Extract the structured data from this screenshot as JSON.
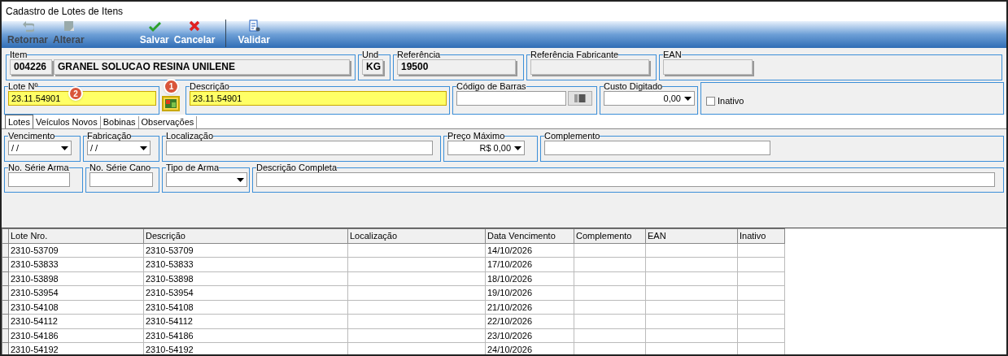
{
  "window": {
    "title": "Cadastro de Lotes de Itens"
  },
  "toolbar": [
    {
      "label": "Retornar",
      "kind": "undo",
      "disabled": true
    },
    {
      "label": "Alterar",
      "kind": "edit",
      "disabled": true
    },
    {
      "label": "Salvar",
      "kind": "check",
      "disabled": false
    },
    {
      "label": "Cancelar",
      "kind": "cross",
      "disabled": false
    },
    {
      "label": "Validar",
      "kind": "doc",
      "disabled": false
    }
  ],
  "item": {
    "legend": "Item",
    "code": "004226",
    "name": "GRANEL SOLUCAO RESINA UNILENE",
    "und_legend": "Und",
    "und": "KG",
    "ref_legend": "Referência",
    "ref": "19500",
    "ref_fab_legend": "Referência Fabricante",
    "ean_legend": "EAN"
  },
  "lote": {
    "legend": "Lote Nº",
    "value": "23.11.54901",
    "badge": "2",
    "button_badge": "1",
    "desc_legend": "Descrição",
    "desc": "23.11.54901",
    "barcode_legend": "Código de Barras",
    "custo_legend": "Custo Digitado",
    "custo": "0,00",
    "inativo_label": "Inativo",
    "inativo_checked": false
  },
  "tabs": [
    {
      "label": "Lotes",
      "selected": true
    },
    {
      "label": "Veículos Novos",
      "selected": false
    },
    {
      "label": "Bobinas",
      "selected": false
    },
    {
      "label": "Observações",
      "selected": false
    }
  ],
  "fields_row1": [
    {
      "legend": "Vencimento",
      "kind": "combo",
      "value": "/ /"
    },
    {
      "legend": "Fabricação",
      "kind": "combo",
      "value": "/ /"
    },
    {
      "legend": "Localização",
      "kind": "text"
    },
    {
      "legend": "Preço Máximo",
      "kind": "money",
      "value": "R$ 0,00"
    },
    {
      "legend": "Complemento",
      "kind": "text"
    }
  ],
  "fields_row2": [
    {
      "legend": "No. Série Arma",
      "kind": "text"
    },
    {
      "legend": "No. Série Cano",
      "kind": "text"
    },
    {
      "legend": "Tipo de Arma",
      "kind": "combo"
    },
    {
      "legend": "Descrição Completa",
      "kind": "text"
    }
  ],
  "table": {
    "columns": [
      "Lote Nro.",
      "Descrição",
      "Localização",
      "Data Vencimento",
      "Complemento",
      "EAN",
      "Inativo"
    ],
    "rows": [
      [
        "2310-53709",
        "2310-53709",
        "",
        "14/10/2026",
        "",
        "",
        ""
      ],
      [
        "2310-53833",
        "2310-53833",
        "",
        "17/10/2026",
        "",
        "",
        ""
      ],
      [
        "2310-53898",
        "2310-53898",
        "",
        "18/10/2026",
        "",
        "",
        ""
      ],
      [
        "2310-53954",
        "2310-53954",
        "",
        "19/10/2026",
        "",
        "",
        ""
      ],
      [
        "2310-54108",
        "2310-54108",
        "",
        "21/10/2026",
        "",
        "",
        ""
      ],
      [
        "2310-54112",
        "2310-54112",
        "",
        "22/10/2026",
        "",
        "",
        ""
      ],
      [
        "2310-54186",
        "2310-54186",
        "",
        "23/10/2026",
        "",
        "",
        ""
      ],
      [
        "2310-54192",
        "2310-54192",
        "",
        "24/10/2026",
        "",
        "",
        ""
      ]
    ]
  }
}
